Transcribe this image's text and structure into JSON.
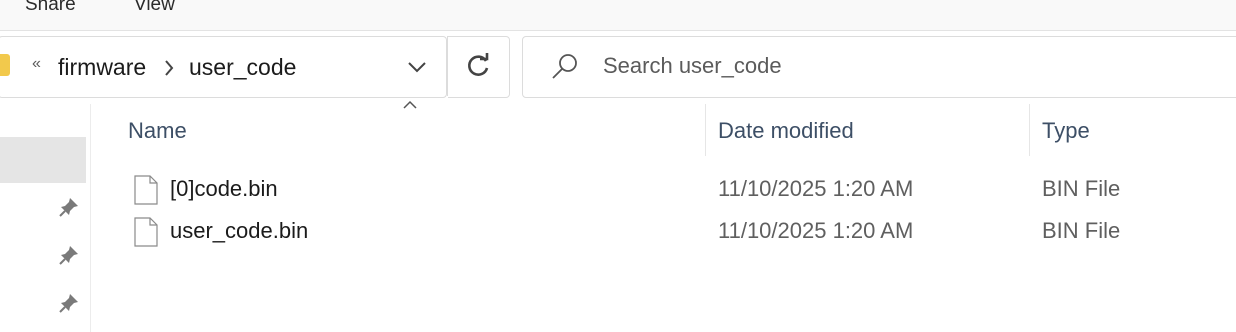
{
  "ribbon": {
    "tabs": [
      "Share",
      "View"
    ]
  },
  "address_bar": {
    "overflow": "«",
    "crumbs": [
      "firmware",
      "user_code"
    ]
  },
  "search": {
    "placeholder": "Search user_code"
  },
  "columns": [
    "Name",
    "Date modified",
    "Type"
  ],
  "files": [
    {
      "name": "[0]code.bin",
      "date": "11/10/2025 1:20 AM",
      "type": "BIN File"
    },
    {
      "name": "user_code.bin",
      "date": "11/10/2025 1:20 AM",
      "type": "BIN File"
    }
  ],
  "icons": {
    "folder": "folder-icon",
    "breadcrumb_sep": "chevron-right-icon",
    "dropdown": "chevron-down-icon",
    "refresh": "refresh-icon",
    "search": "search-icon",
    "pin": "pin-icon",
    "file": "file-icon",
    "sort": "chevron-up-icon"
  },
  "colors": {
    "folder": "#f2c94c",
    "header_text": "#3d4f66",
    "selection": "#e5e5e5"
  }
}
